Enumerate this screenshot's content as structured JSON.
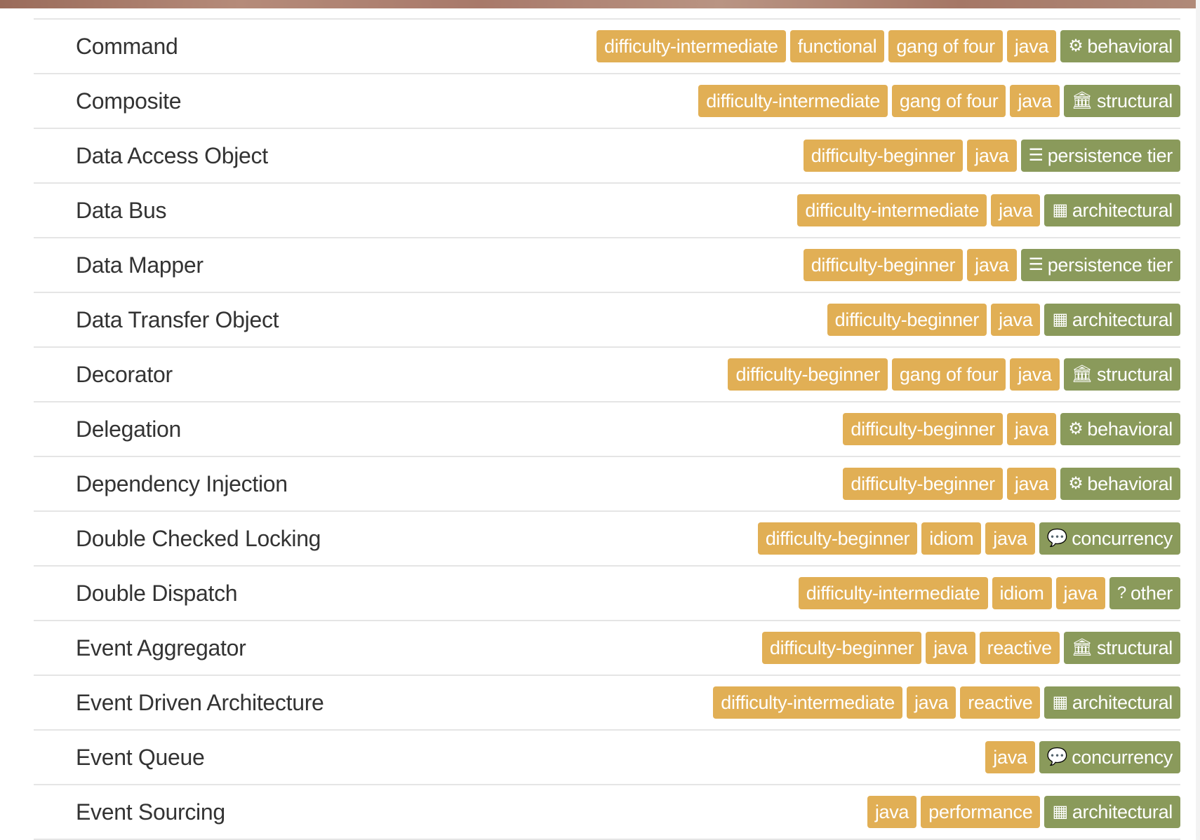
{
  "colors": {
    "keyword_tag": "#e1af55",
    "category_tag": "#8a9a5b",
    "title_text": "#333333"
  },
  "patterns": [
    {
      "title": "Command",
      "tags": [
        "difficulty-intermediate",
        "functional",
        "gang of four",
        "java"
      ],
      "category": {
        "label": "behavioral",
        "icon": "cogs-icon",
        "glyph": "⚙"
      }
    },
    {
      "title": "Composite",
      "tags": [
        "difficulty-intermediate",
        "gang of four",
        "java"
      ],
      "category": {
        "label": "structural",
        "icon": "bank-icon",
        "glyph": "🏛"
      }
    },
    {
      "title": "Data Access Object",
      "tags": [
        "difficulty-beginner",
        "java"
      ],
      "category": {
        "label": "persistence tier",
        "icon": "database-icon",
        "glyph": "☰"
      }
    },
    {
      "title": "Data Bus",
      "tags": [
        "difficulty-intermediate",
        "java"
      ],
      "category": {
        "label": "architectural",
        "icon": "building-icon",
        "glyph": "▦"
      }
    },
    {
      "title": "Data Mapper",
      "tags": [
        "difficulty-beginner",
        "java"
      ],
      "category": {
        "label": "persistence tier",
        "icon": "database-icon",
        "glyph": "☰"
      }
    },
    {
      "title": "Data Transfer Object",
      "tags": [
        "difficulty-beginner",
        "java"
      ],
      "category": {
        "label": "architectural",
        "icon": "building-icon",
        "glyph": "▦"
      }
    },
    {
      "title": "Decorator",
      "tags": [
        "difficulty-beginner",
        "gang of four",
        "java"
      ],
      "category": {
        "label": "structural",
        "icon": "bank-icon",
        "glyph": "🏛"
      }
    },
    {
      "title": "Delegation",
      "tags": [
        "difficulty-beginner",
        "java"
      ],
      "category": {
        "label": "behavioral",
        "icon": "cogs-icon",
        "glyph": "⚙"
      }
    },
    {
      "title": "Dependency Injection",
      "tags": [
        "difficulty-beginner",
        "java"
      ],
      "category": {
        "label": "behavioral",
        "icon": "cogs-icon",
        "glyph": "⚙"
      }
    },
    {
      "title": "Double Checked Locking",
      "tags": [
        "difficulty-beginner",
        "idiom",
        "java"
      ],
      "category": {
        "label": "concurrency",
        "icon": "comments-icon",
        "glyph": "💬"
      }
    },
    {
      "title": "Double Dispatch",
      "tags": [
        "difficulty-intermediate",
        "idiom",
        "java"
      ],
      "category": {
        "label": "other",
        "icon": "question-icon",
        "glyph": "?"
      }
    },
    {
      "title": "Event Aggregator",
      "tags": [
        "difficulty-beginner",
        "java",
        "reactive"
      ],
      "category": {
        "label": "structural",
        "icon": "bank-icon",
        "glyph": "🏛"
      }
    },
    {
      "title": "Event Driven Architecture",
      "tags": [
        "difficulty-intermediate",
        "java",
        "reactive"
      ],
      "category": {
        "label": "architectural",
        "icon": "building-icon",
        "glyph": "▦"
      }
    },
    {
      "title": "Event Queue",
      "tags": [
        "java"
      ],
      "category": {
        "label": "concurrency",
        "icon": "comments-icon",
        "glyph": "💬"
      }
    },
    {
      "title": "Event Sourcing",
      "tags": [
        "java",
        "performance"
      ],
      "category": {
        "label": "architectural",
        "icon": "building-icon",
        "glyph": "▦"
      }
    }
  ]
}
